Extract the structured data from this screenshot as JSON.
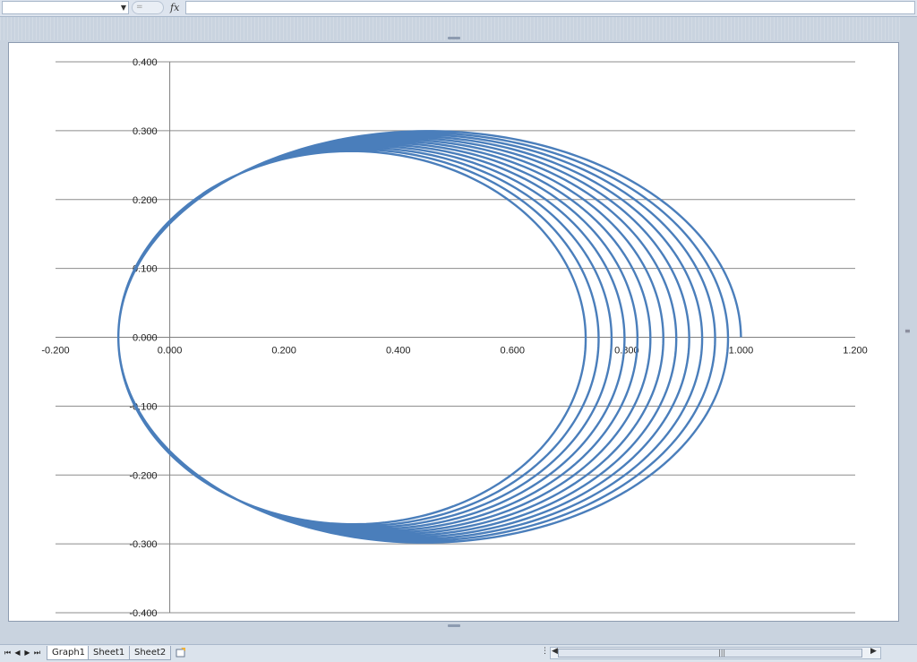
{
  "formula_bar": {
    "name_box_value": "",
    "formula_value": "=",
    "fx_label": "fx"
  },
  "sheet_tabs": [
    {
      "label": "Graph1",
      "active": true
    },
    {
      "label": "Sheet1",
      "active": false
    },
    {
      "label": "Sheet2",
      "active": false
    }
  ],
  "colors": {
    "series": "#4a7ebb",
    "gridline": "#8c8c8c",
    "axis": "#7f7f7f"
  },
  "chart_data": {
    "type": "scatter",
    "title": "",
    "xlabel": "",
    "ylabel": "",
    "xlim": [
      -0.2,
      1.2
    ],
    "ylim": [
      -0.4,
      0.4
    ],
    "x_ticks": [
      -0.2,
      0.0,
      0.2,
      0.4,
      0.6,
      0.8,
      1.0,
      1.2
    ],
    "y_ticks": [
      0.4,
      0.3,
      0.2,
      0.1,
      0.0,
      -0.1,
      -0.2,
      -0.3,
      -0.4
    ],
    "x_tick_labels": [
      "-0.200",
      "0.000",
      "0.200",
      "0.400",
      "0.600",
      "0.800",
      "1.000",
      "1.200"
    ],
    "y_tick_labels": [
      "0.400",
      "0.300",
      "0.200",
      "0.100",
      "0.000",
      "-0.100",
      "-0.200",
      "-0.300",
      "-0.400"
    ],
    "grid": {
      "horizontal": true,
      "vertical": false
    },
    "legend": "none",
    "series": [
      {
        "description_only_in_script": false,
        "start_point": [
          1.0,
          0.0
        ],
        "end_point": [
          0.57,
          0.215
        ],
        "min_x": -0.09,
        "max_y": 0.3,
        "min_y": -0.295,
        "loops": 12,
        "outermost_right_x": 1.0,
        "innermost_right_x": 0.72
      }
    ]
  }
}
